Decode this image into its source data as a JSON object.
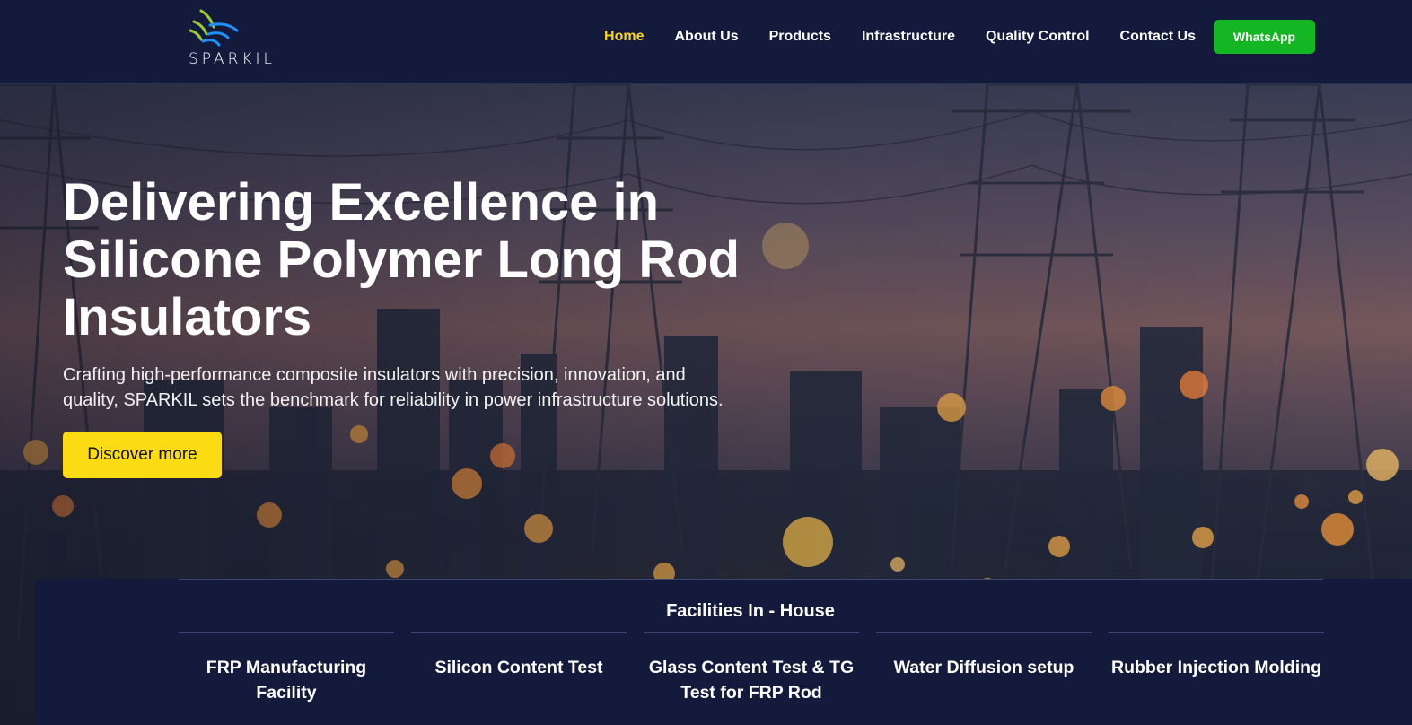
{
  "brand": {
    "name": "SPARKIL"
  },
  "nav": {
    "items": [
      {
        "label": "Home",
        "active": true
      },
      {
        "label": "About Us"
      },
      {
        "label": "Products"
      },
      {
        "label": "Infrastructure"
      },
      {
        "label": "Quality Control"
      },
      {
        "label": "Contact Us"
      }
    ],
    "whatsapp_label": "WhatsApp"
  },
  "hero": {
    "title": "Delivering Excellence in Silicone Polymer Long Rod Insulators",
    "subtitle": "Crafting high-performance composite insulators with precision, innovation, and quality, SPARKIL sets the benchmark for reliability in power infrastructure solutions.",
    "cta_label": "Discover more"
  },
  "facilities": {
    "title": "Facilities In - House",
    "items": [
      "FRP Manufacturing Facility",
      "Silicon Content Test",
      "Glass Content Test & TG Test for FRP Rod",
      "Water Diffusion setup",
      "Rubber Injection Molding"
    ]
  },
  "colors": {
    "header_bg": "#141a3c",
    "nav_active": "#f6d61b",
    "whatsapp_green": "#15b623",
    "cta_yellow": "#fbdc14",
    "logo_green": "#9acd32",
    "logo_blue": "#1e90ff"
  }
}
